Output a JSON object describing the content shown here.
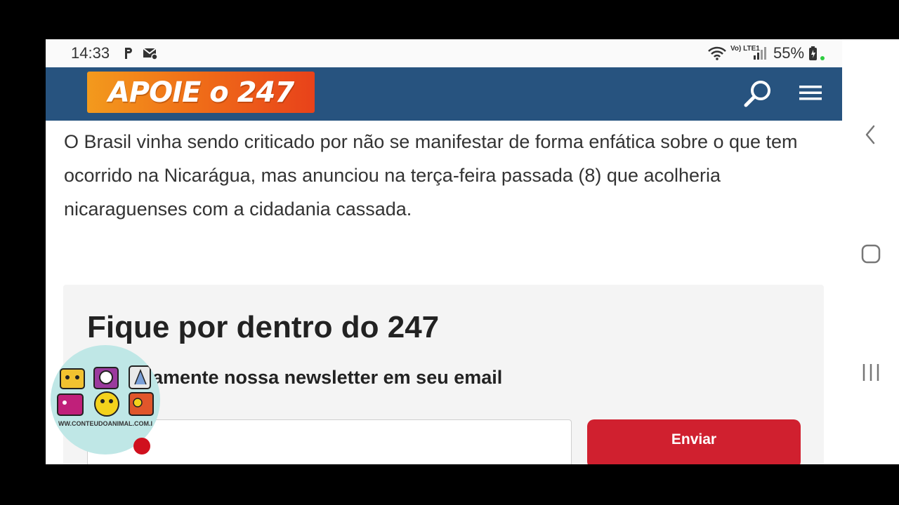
{
  "status_bar": {
    "time": "14:33",
    "battery_percent": "55%",
    "network_label": "Vo) LTE1",
    "icons": [
      "parking-notification-icon",
      "mail-sync-icon",
      "wifi-icon",
      "volte-icon",
      "signal-icon",
      "battery-charging-icon"
    ]
  },
  "header": {
    "support_label": "APOIE o 247",
    "search_icon": "search-icon",
    "menu_icon": "hamburger-menu-icon",
    "colors": {
      "header_bg": "#27537f",
      "banner_start": "#f39a1d",
      "banner_end": "#e8421a"
    }
  },
  "article": {
    "paragraph": " O Brasil vinha sendo criticado por não se manifestar de forma enfática sobre o que tem ocorrido na Nicarágua, mas anunciou na terça-feira passada (8) que acolheria nicaraguenses com a cidadania cassada."
  },
  "newsletter": {
    "title": "Fique por dentro do 247",
    "subtitle": "diariamente nossa newsletter em seu email",
    "email_value": "",
    "send_label": "Enviar",
    "colors": {
      "button": "#d0202f",
      "panel_bg": "#f4f4f4"
    }
  },
  "side_nav": {
    "back_icon": "chevron-left-icon",
    "home_icon": "rounded-square-home-icon",
    "recents_icon": "recents-bars-icon"
  },
  "overlay": {
    "logo_text": "WW.CONTEUDOANIMAL.COM.I",
    "recording_icon": "recording-dot-icon"
  }
}
